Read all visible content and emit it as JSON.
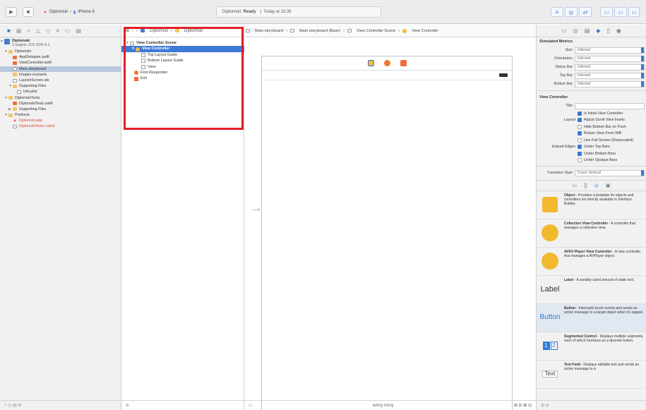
{
  "toolbar": {
    "scheme": "Diplomski",
    "device": "iPhone 6",
    "status_project": "Diplomski:",
    "status_state": "Ready",
    "status_time": "Today at 15:35"
  },
  "navigator": {
    "project_name": "Diplomski",
    "project_sub": "2 targets, iOS SDK 8.1",
    "items": [
      {
        "label": "Diplomski",
        "type": "folder"
      },
      {
        "label": "AppDelegate.swift",
        "type": "swift"
      },
      {
        "label": "ViewController.swift",
        "type": "swift"
      },
      {
        "label": "Main.storyboard",
        "type": "doc"
      },
      {
        "label": "Images.xcassets",
        "type": "folder"
      },
      {
        "label": "LaunchScreen.xib",
        "type": "doc"
      },
      {
        "label": "Supporting Files",
        "type": "folder"
      },
      {
        "label": "Info.plist",
        "type": "doc"
      },
      {
        "label": "DiplomskiTests",
        "type": "folder"
      },
      {
        "label": "DiplomskiTests.swift",
        "type": "swift"
      },
      {
        "label": "Supporting Files",
        "type": "folder"
      },
      {
        "label": "Products",
        "type": "folder"
      },
      {
        "label": "Diplomski.app",
        "type": "app"
      },
      {
        "label": "DiplomskiTests.xctest",
        "type": "doc"
      }
    ]
  },
  "outline": {
    "jump_items": [
      "Diplomski",
      "Diplomski"
    ],
    "scene": "View Controller Scene",
    "vc": "View Controller",
    "top_guide": "Top Layout Guide",
    "bottom_guide": "Bottom Layout Guide",
    "view": "View",
    "first_responder": "First Responder",
    "exit": "Exit"
  },
  "jumpbar": {
    "items": [
      "Main.storyboard",
      "Main.storyboard (Base)",
      "View Controller Scene",
      "View Controller"
    ]
  },
  "canvas": {
    "size_class": "wAny hAny",
    "zoom_label": "Any"
  },
  "inspector": {
    "simulated_title": "Simulated Metrics",
    "metrics": [
      {
        "label": "Size",
        "value": "Inferred"
      },
      {
        "label": "Orientation",
        "value": "Inferred"
      },
      {
        "label": "Status Bar",
        "value": "Inferred"
      },
      {
        "label": "Top Bar",
        "value": "Inferred"
      },
      {
        "label": "Bottom Bar",
        "value": "Inferred"
      }
    ],
    "vc_title": "View Controller",
    "title_label": "Title",
    "initial_vc": "Is Initial View Controller",
    "layout_label": "Layout",
    "layout_opts": [
      {
        "label": "Adjust Scroll View Insets",
        "checked": true
      },
      {
        "label": "Hide Bottom Bar on Push",
        "checked": false
      },
      {
        "label": "Resize View From NIB",
        "checked": true
      },
      {
        "label": "Use Full Screen (Deprecated)",
        "checked": false
      }
    ],
    "edges_label": "Extend Edges",
    "edges_opts": [
      {
        "label": "Under Top Bars",
        "checked": true
      },
      {
        "label": "Under Bottom Bars",
        "checked": true
      },
      {
        "label": "Under Opaque Bars",
        "checked": false
      }
    ],
    "transition_label": "Transition Style",
    "transition_value": "Cover Vertical"
  },
  "library": [
    {
      "name": "Object",
      "desc": "- Provides a template for objects and controllers not directly available in Interface Builder.",
      "thumb": "cube"
    },
    {
      "name": "Collection View Controller",
      "desc": "- A controller that manages a collection view.",
      "thumb": "circle"
    },
    {
      "name": "AVKit Player View Controller",
      "desc": "- A view controller that manages a AVPlayer object.",
      "thumb": "circle"
    },
    {
      "name": "Label",
      "desc": "- A variably sized amount of static text.",
      "thumb": "Label"
    },
    {
      "name": "Button",
      "desc": "- Intercepts touch events and sends an action message to a target object when it's tapped.",
      "thumb": "Button"
    },
    {
      "name": "Segmented Control",
      "desc": "- Displays multiple segments, each of which functions as a discrete button.",
      "thumb": "segment"
    },
    {
      "name": "Text Field",
      "desc": "- Displays editable text and sends an action message to a",
      "thumb": "Text"
    }
  ],
  "segment_labels": [
    "1",
    "2"
  ],
  "colors": {
    "accent": "#3a7bd5",
    "highlight": "#e0202a",
    "selection": "#3e7bd6"
  }
}
